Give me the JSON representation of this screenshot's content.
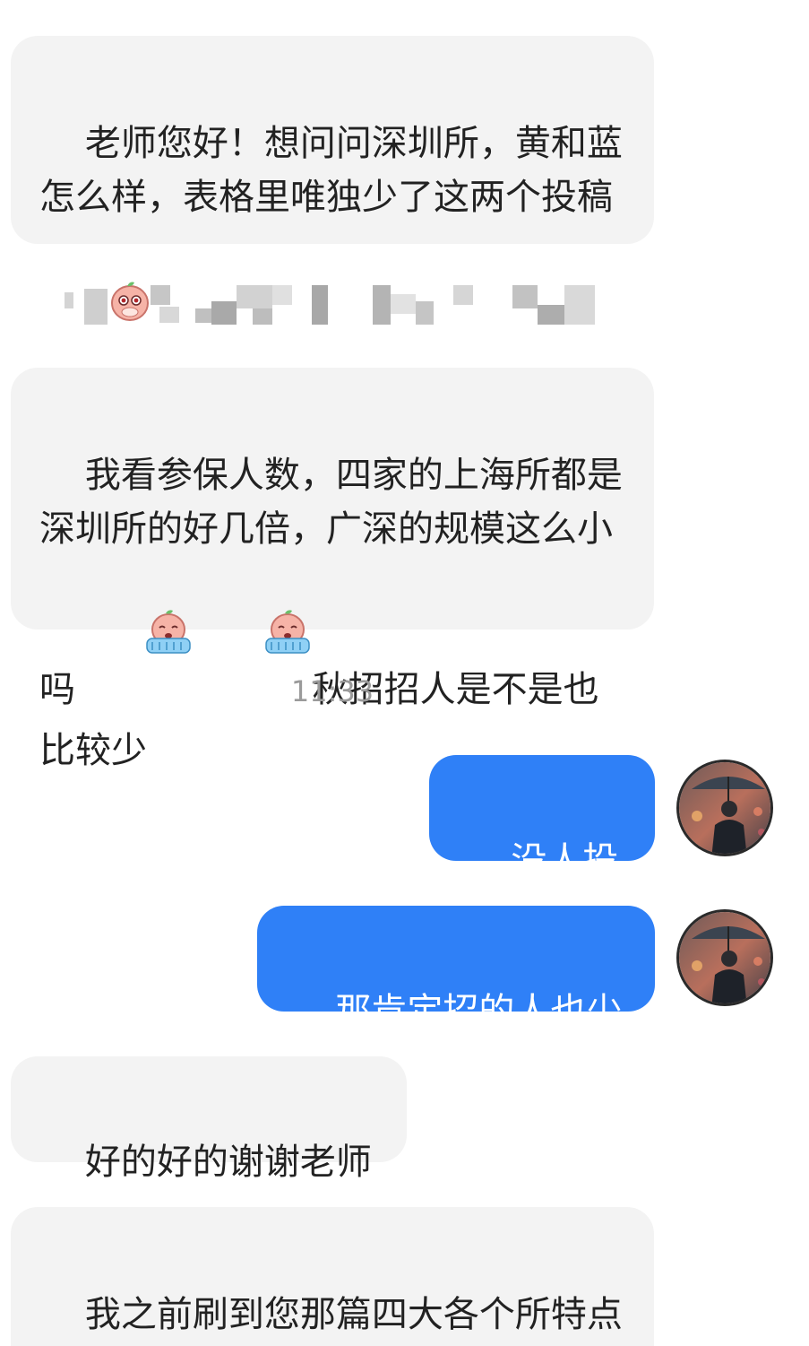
{
  "messages": [
    {
      "id": "m1",
      "side": "in",
      "text": "老师您好！想问问深圳所，黄和蓝怎么样，表格里唯独少了这两个投稿"
    },
    {
      "id": "m2",
      "side": "in",
      "text": "我看参保人数，四家的上海所都是深圳所的好几倍，广深的规模这么小吗",
      "text_after": "秋招招人是不是也比较少"
    },
    {
      "id": "m3",
      "side": "out",
      "text": "没人投啊"
    },
    {
      "id": "m4",
      "side": "out",
      "text": "那肯定招的人也少"
    },
    {
      "id": "m5",
      "side": "in",
      "text": "好的好的谢谢老师"
    },
    {
      "id": "m6",
      "side": "in",
      "text": "我之前刷到您那篇四大各个所特点的贴，广深似乎难度小一"
    }
  ],
  "timestamp": "11:33",
  "colors": {
    "incoming_bubble": "#f3f3f3",
    "outgoing_bubble": "#2f80f7",
    "timestamp": "#9a9a9a"
  },
  "icons": {
    "shy": "shy-peach-emoji-icon",
    "crying": "crying-peach-emoji-icon",
    "avatar": "avatar-umbrella-man"
  }
}
